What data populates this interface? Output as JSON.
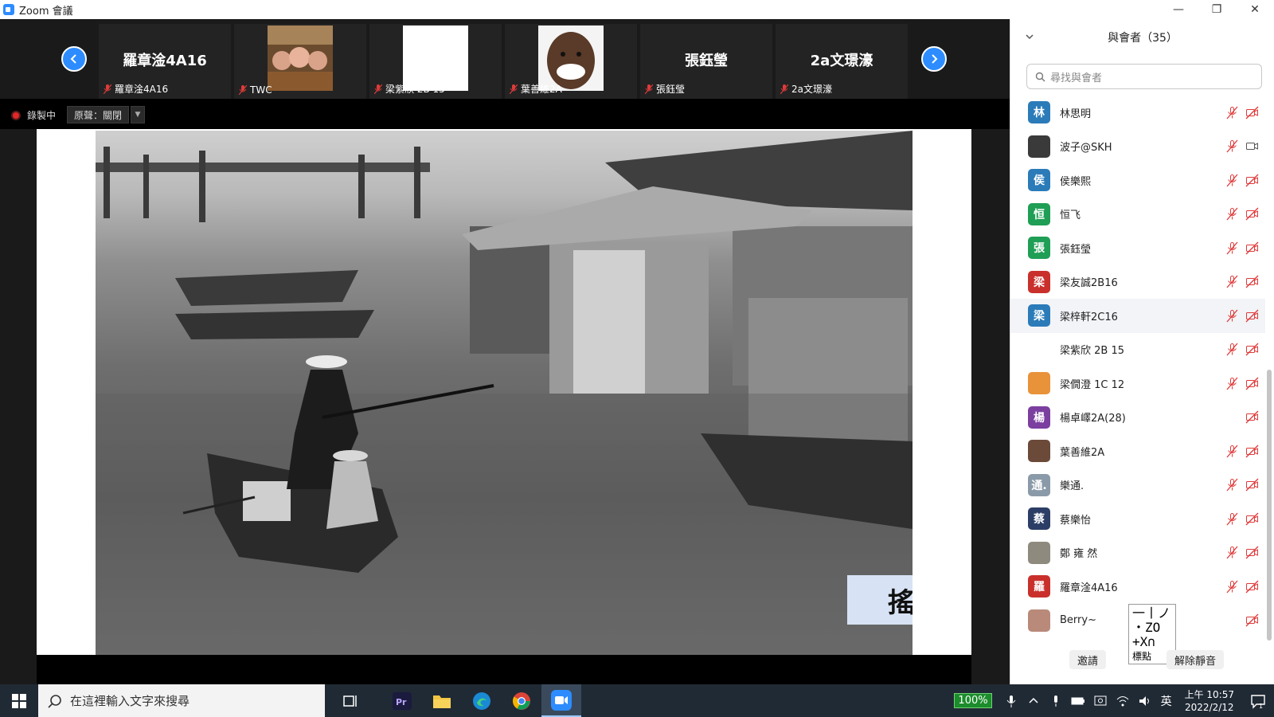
{
  "window": {
    "title": "Zoom 會議",
    "minimize": "—",
    "maximize": "❐",
    "close": "✕"
  },
  "video_strip": {
    "tiles": [
      {
        "big_name": "羅章淦4A16",
        "label": "羅章淦4A16"
      },
      {
        "big_name": "",
        "label": "TWC"
      },
      {
        "big_name": "",
        "label": "梁紫欣 2B 15"
      },
      {
        "big_name": "",
        "label": "葉善維2A"
      },
      {
        "big_name": "張鈺瑩",
        "label": "張鈺瑩"
      },
      {
        "big_name": "2a文璟濠",
        "label": "2a文璟濠"
      }
    ]
  },
  "recording": {
    "label": "錄製中",
    "original_sound": "原聲：關閉"
  },
  "shared_slide": {
    "caption": "搖櫓"
  },
  "participants_panel": {
    "header": "與會者（35）",
    "search_placeholder": "尋找與會者",
    "participants": [
      {
        "avatar_text": "林",
        "avatar_color": "#2b7bb9",
        "name": "林思明",
        "mic": "muted",
        "video": "off"
      },
      {
        "avatar_text": "",
        "avatar_color": "#3a3a3a",
        "name": "波子@SKH",
        "mic": "muted",
        "video": "on"
      },
      {
        "avatar_text": "侯",
        "avatar_color": "#2b7bb9",
        "name": "侯樂熙",
        "mic": "muted",
        "video": "off"
      },
      {
        "avatar_text": "恒",
        "avatar_color": "#1f9e55",
        "name": "恒飞",
        "mic": "muted",
        "video": "off"
      },
      {
        "avatar_text": "張",
        "avatar_color": "#1f9e55",
        "name": "張鈺瑩",
        "mic": "muted",
        "video": "off"
      },
      {
        "avatar_text": "梁",
        "avatar_color": "#c9302c",
        "name": "梁友誠2B16",
        "mic": "muted",
        "video": "off"
      },
      {
        "avatar_text": "梁",
        "avatar_color": "#2b7bb9",
        "name": "梁梓軒2C16",
        "mic": "muted",
        "video": "off"
      },
      {
        "avatar_text": "",
        "avatar_color": "#ffffff",
        "name": "梁紫欣 2B 15",
        "mic": "muted",
        "video": "off"
      },
      {
        "avatar_text": "",
        "avatar_color": "#e8923a",
        "name": "梁僩澄 1C 12",
        "mic": "muted",
        "video": "off"
      },
      {
        "avatar_text": "楊",
        "avatar_color": "#7b3fa0",
        "name": "楊卓嶧2A(28)",
        "mic": "none",
        "video": "off"
      },
      {
        "avatar_text": "",
        "avatar_color": "#6b4a3a",
        "name": "葉善維2A",
        "mic": "muted",
        "video": "off"
      },
      {
        "avatar_text": "通.",
        "avatar_color": "#8a9aa8",
        "name": "樂通.",
        "mic": "muted",
        "video": "off"
      },
      {
        "avatar_text": "蔡",
        "avatar_color": "#2c3e66",
        "name": "蔡樂怡",
        "mic": "muted",
        "video": "off"
      },
      {
        "avatar_text": "",
        "avatar_color": "#8e8a7e",
        "name": "鄭 雍 然",
        "mic": "muted",
        "video": "off"
      },
      {
        "avatar_text": "羅",
        "avatar_color": "#c9302c",
        "name": "羅章淦4A16",
        "mic": "muted",
        "video": "off"
      },
      {
        "avatar_text": "",
        "avatar_color": "#b98a7a",
        "name": "Berry~",
        "mic": "none",
        "video": "off"
      }
    ],
    "invite_label": "邀請",
    "unmute_all_label": "解除靜音"
  },
  "ime_popup": {
    "row1": "一丨ノ",
    "row2": "・ZO",
    "row3": "+X∩",
    "label": "標點"
  },
  "taskbar": {
    "search_placeholder": "在這裡輸入文字來搜尋",
    "battery": "100%",
    "ime_lang": "英",
    "time": "上午 10:57",
    "date": "2022/2/12",
    "notification_count": "1"
  }
}
